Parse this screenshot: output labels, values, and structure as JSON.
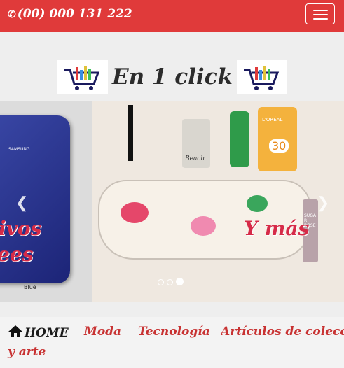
{
  "header": {
    "phone": "(00) 000 131 222",
    "phone_icon": "phone-volume-icon",
    "menu_icon": "hamburger-icon"
  },
  "brand": {
    "title": "En 1 click",
    "logo_icon": "shopping-cart-icon"
  },
  "carousel": {
    "left_slide": {
      "phone_brand": "SAMSUNG",
      "text_line1": "ivos",
      "text_line2": "ees",
      "label": "Blue"
    },
    "right_slide": {
      "text": "Y más",
      "product_labels": [
        "Beach",
        "L'ORÉAL",
        "30",
        "SUGAR ROSE"
      ]
    },
    "prev_icon": "chevron-left-icon",
    "next_icon": "chevron-right-icon",
    "indicators": 3,
    "active_index": 2
  },
  "nav": {
    "home": "HOME",
    "home_icon": "home-icon",
    "items": [
      "Moda",
      "Tecnología",
      "Artículos de colección",
      "y arte"
    ]
  }
}
